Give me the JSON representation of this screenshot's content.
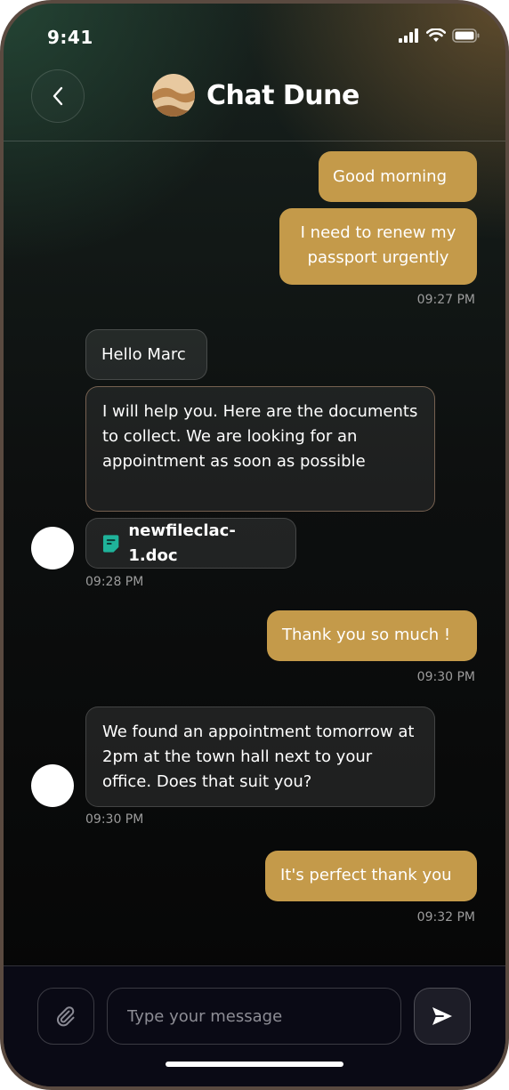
{
  "status_bar": {
    "time": "9:41"
  },
  "header": {
    "title": "Chat Dune"
  },
  "messages": [
    {
      "from": "me",
      "text": "Good morning"
    },
    {
      "from": "me",
      "text": "I need to renew my passport urgently"
    },
    {
      "from": "me",
      "timestamp": "09:27 PM"
    },
    {
      "from": "agent",
      "text": "Hello Marc"
    },
    {
      "from": "agent",
      "text": "I will help you. Here are the documents to collect. We are looking for an appointment as soon as possible"
    },
    {
      "from": "agent",
      "file_name": "newfileclac-1.doc",
      "timestamp": "09:28 PM"
    },
    {
      "from": "me",
      "text": "Thank you so much !",
      "timestamp": "09:30 PM"
    },
    {
      "from": "agent",
      "text": "We found an appointment tomorrow at 2pm at the town hall next to your office. Does that suit you?",
      "timestamp": "09:30 PM"
    },
    {
      "from": "me",
      "text": "It's perfect thank you",
      "timestamp": "09:32 PM"
    }
  ],
  "composer": {
    "placeholder": "Type your message"
  },
  "colors": {
    "outgoing_bubble": "#c49a4a",
    "file_icon": "#1fb39a",
    "send_icon": "#ffffff"
  },
  "icons": {
    "back": "chevron-left-icon",
    "attach": "paperclip-icon",
    "send": "send-icon",
    "file": "document-icon"
  }
}
